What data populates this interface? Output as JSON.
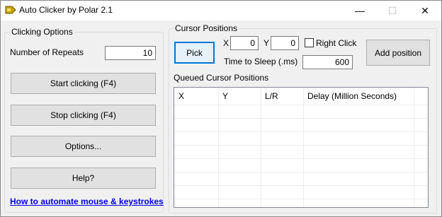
{
  "window": {
    "title": "Auto Clicker by Polar 2.1",
    "controls": {
      "minimize": "—",
      "maximize": "☐",
      "close": "✕"
    }
  },
  "clicking_options": {
    "group_label": "Clicking Options",
    "repeats_label": "Number of Repeats",
    "repeats_value": "10",
    "start_button": "Start clicking (F4)",
    "stop_button": "Stop clicking (F4)",
    "options_button": "Options...",
    "help_button": "Help?"
  },
  "link": {
    "text": "How to automate mouse & keystrokes",
    "color": "#0000ee"
  },
  "cursor_positions": {
    "group_label": "Cursor Positions",
    "pick_button": "Pick",
    "x_label": "X",
    "x_value": "0",
    "y_label": "Y",
    "y_value": "0",
    "right_click_label": "Right Click",
    "right_click_checked": false,
    "sleep_label": "Time to Sleep (.ms)",
    "sleep_value": "600",
    "add_button": "Add position"
  },
  "queue": {
    "label": "Queued Cursor Positions",
    "columns": [
      "X",
      "Y",
      "L/R",
      "Delay (Million Seconds)"
    ],
    "rows": []
  },
  "colors": {
    "accent": "#0078d7",
    "window_bg": "#f0f0f0",
    "button_bg": "#e1e1e1"
  }
}
